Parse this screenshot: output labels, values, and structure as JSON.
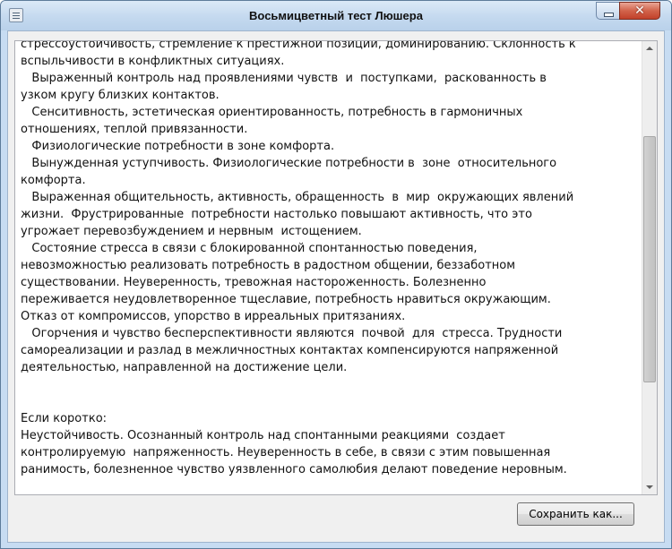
{
  "window": {
    "title": "Восьмицветный тест Люшера",
    "close_glyph": "✕"
  },
  "memo": {
    "lines": [
      "стрессоустойчивость, стремление к престижной позиции, доминированию. Склонность к",
      "вспыльчивости в конфликтных ситуациях.",
      "   Выраженный контроль над проявлениями чувств  и  поступками,  раскованность в",
      "узком кругу близких контактов.",
      "   Сенситивность, эстетическая ориентированность, потребность в гармоничных",
      "отношениях, теплой привязанности.",
      "   Физиологические потребности в зоне комфорта.",
      "   Вынужденная уступчивость. Физиологические потребности в  зоне  относительного",
      "комфорта.",
      "   Выраженная общительность, активность, обращенность  в  мир  окружающих явлений",
      "жизни.  Фрустрированные  потребности настолько повышают активность, что это",
      "угрожает перевозбуждением и нервным  истощением.",
      "   Состояние стресса в связи с блокированной спонтанностью поведения,",
      "невозможностью реализовать потребность в радостном общении, беззаботном",
      "существовании. Неуверенность, тревожная настороженность. Болезненно",
      "переживается неудовлетворенное тщеславие, потребность нравиться окружающим.",
      "Отказ от компромиссов, упорство в ирреальных притязаниях.",
      "   Огорчения и чувство бесперспективности являются  почвой  для  стресса. Трудности",
      "самореализации и разлад в межличностных контактах компенсируются напряженной",
      "деятельностью, направленной на достижение цели.",
      "",
      "",
      "Если коротко:",
      "Неустойчивость. Осознанный контроль над спонтанными реакциями  создает",
      "контролируемую  напряженность. Неуверенность в себе, в связи с этим повышенная",
      "ранимость, болезненное чувство уязвленного самолюбия делают поведение неровным."
    ],
    "scroll_position": 0.45
  },
  "buttons": {
    "save_label": "Сохранить как..."
  }
}
